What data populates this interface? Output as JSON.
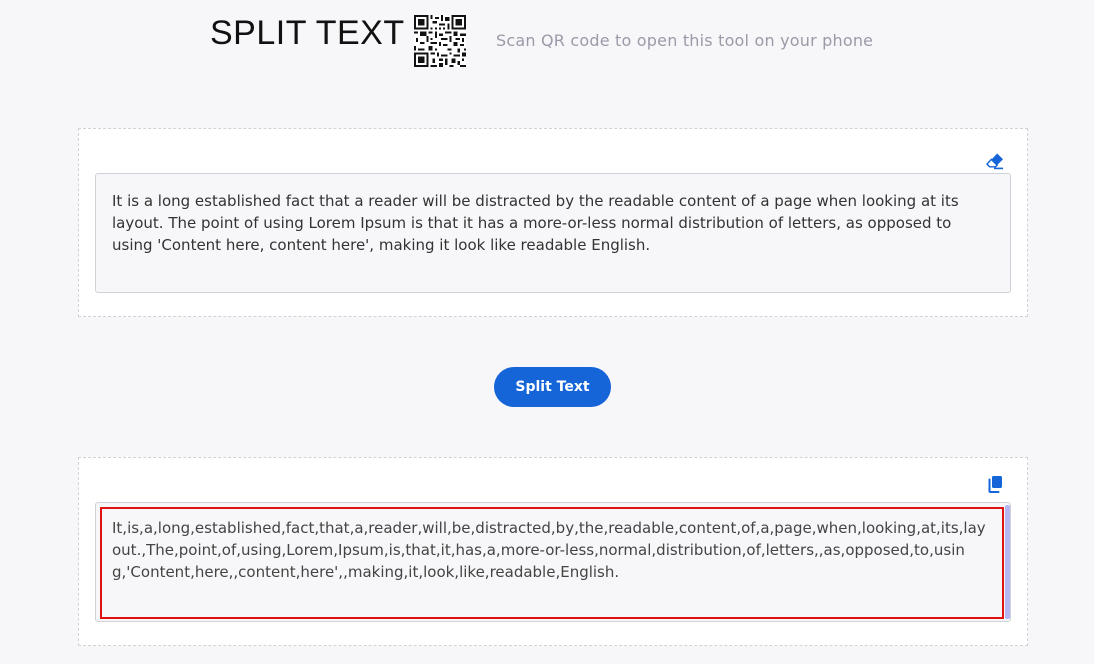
{
  "header": {
    "title": "SPLIT TEXT",
    "qr_caption": "Scan QR code to open this tool on your phone"
  },
  "input": {
    "text": "It is a long established fact that a reader will be distracted by the readable content of a page when looking at its layout. The point of using Lorem Ipsum is that it has a more-or-less normal distribution of letters, as opposed to using 'Content here, content here', making it look like readable English.",
    "clear_icon": "eraser-icon"
  },
  "action": {
    "split_label": "Split Text"
  },
  "output": {
    "text": "It,is,a,long,established,fact,that,a,reader,will,be,distracted,by,the,readable,content,of,a,page,when,looking,at,its,layout.,The,point,of,using,Lorem,Ipsum,is,that,it,has,a,more-or-less,normal,distribution,of,letters,,as,opposed,to,using,'Content,here,,content,here',,making,it,look,like,readable,English.",
    "copy_icon": "copy-icon"
  },
  "colors": {
    "accent": "#1565d8",
    "highlight": "#e01111"
  }
}
